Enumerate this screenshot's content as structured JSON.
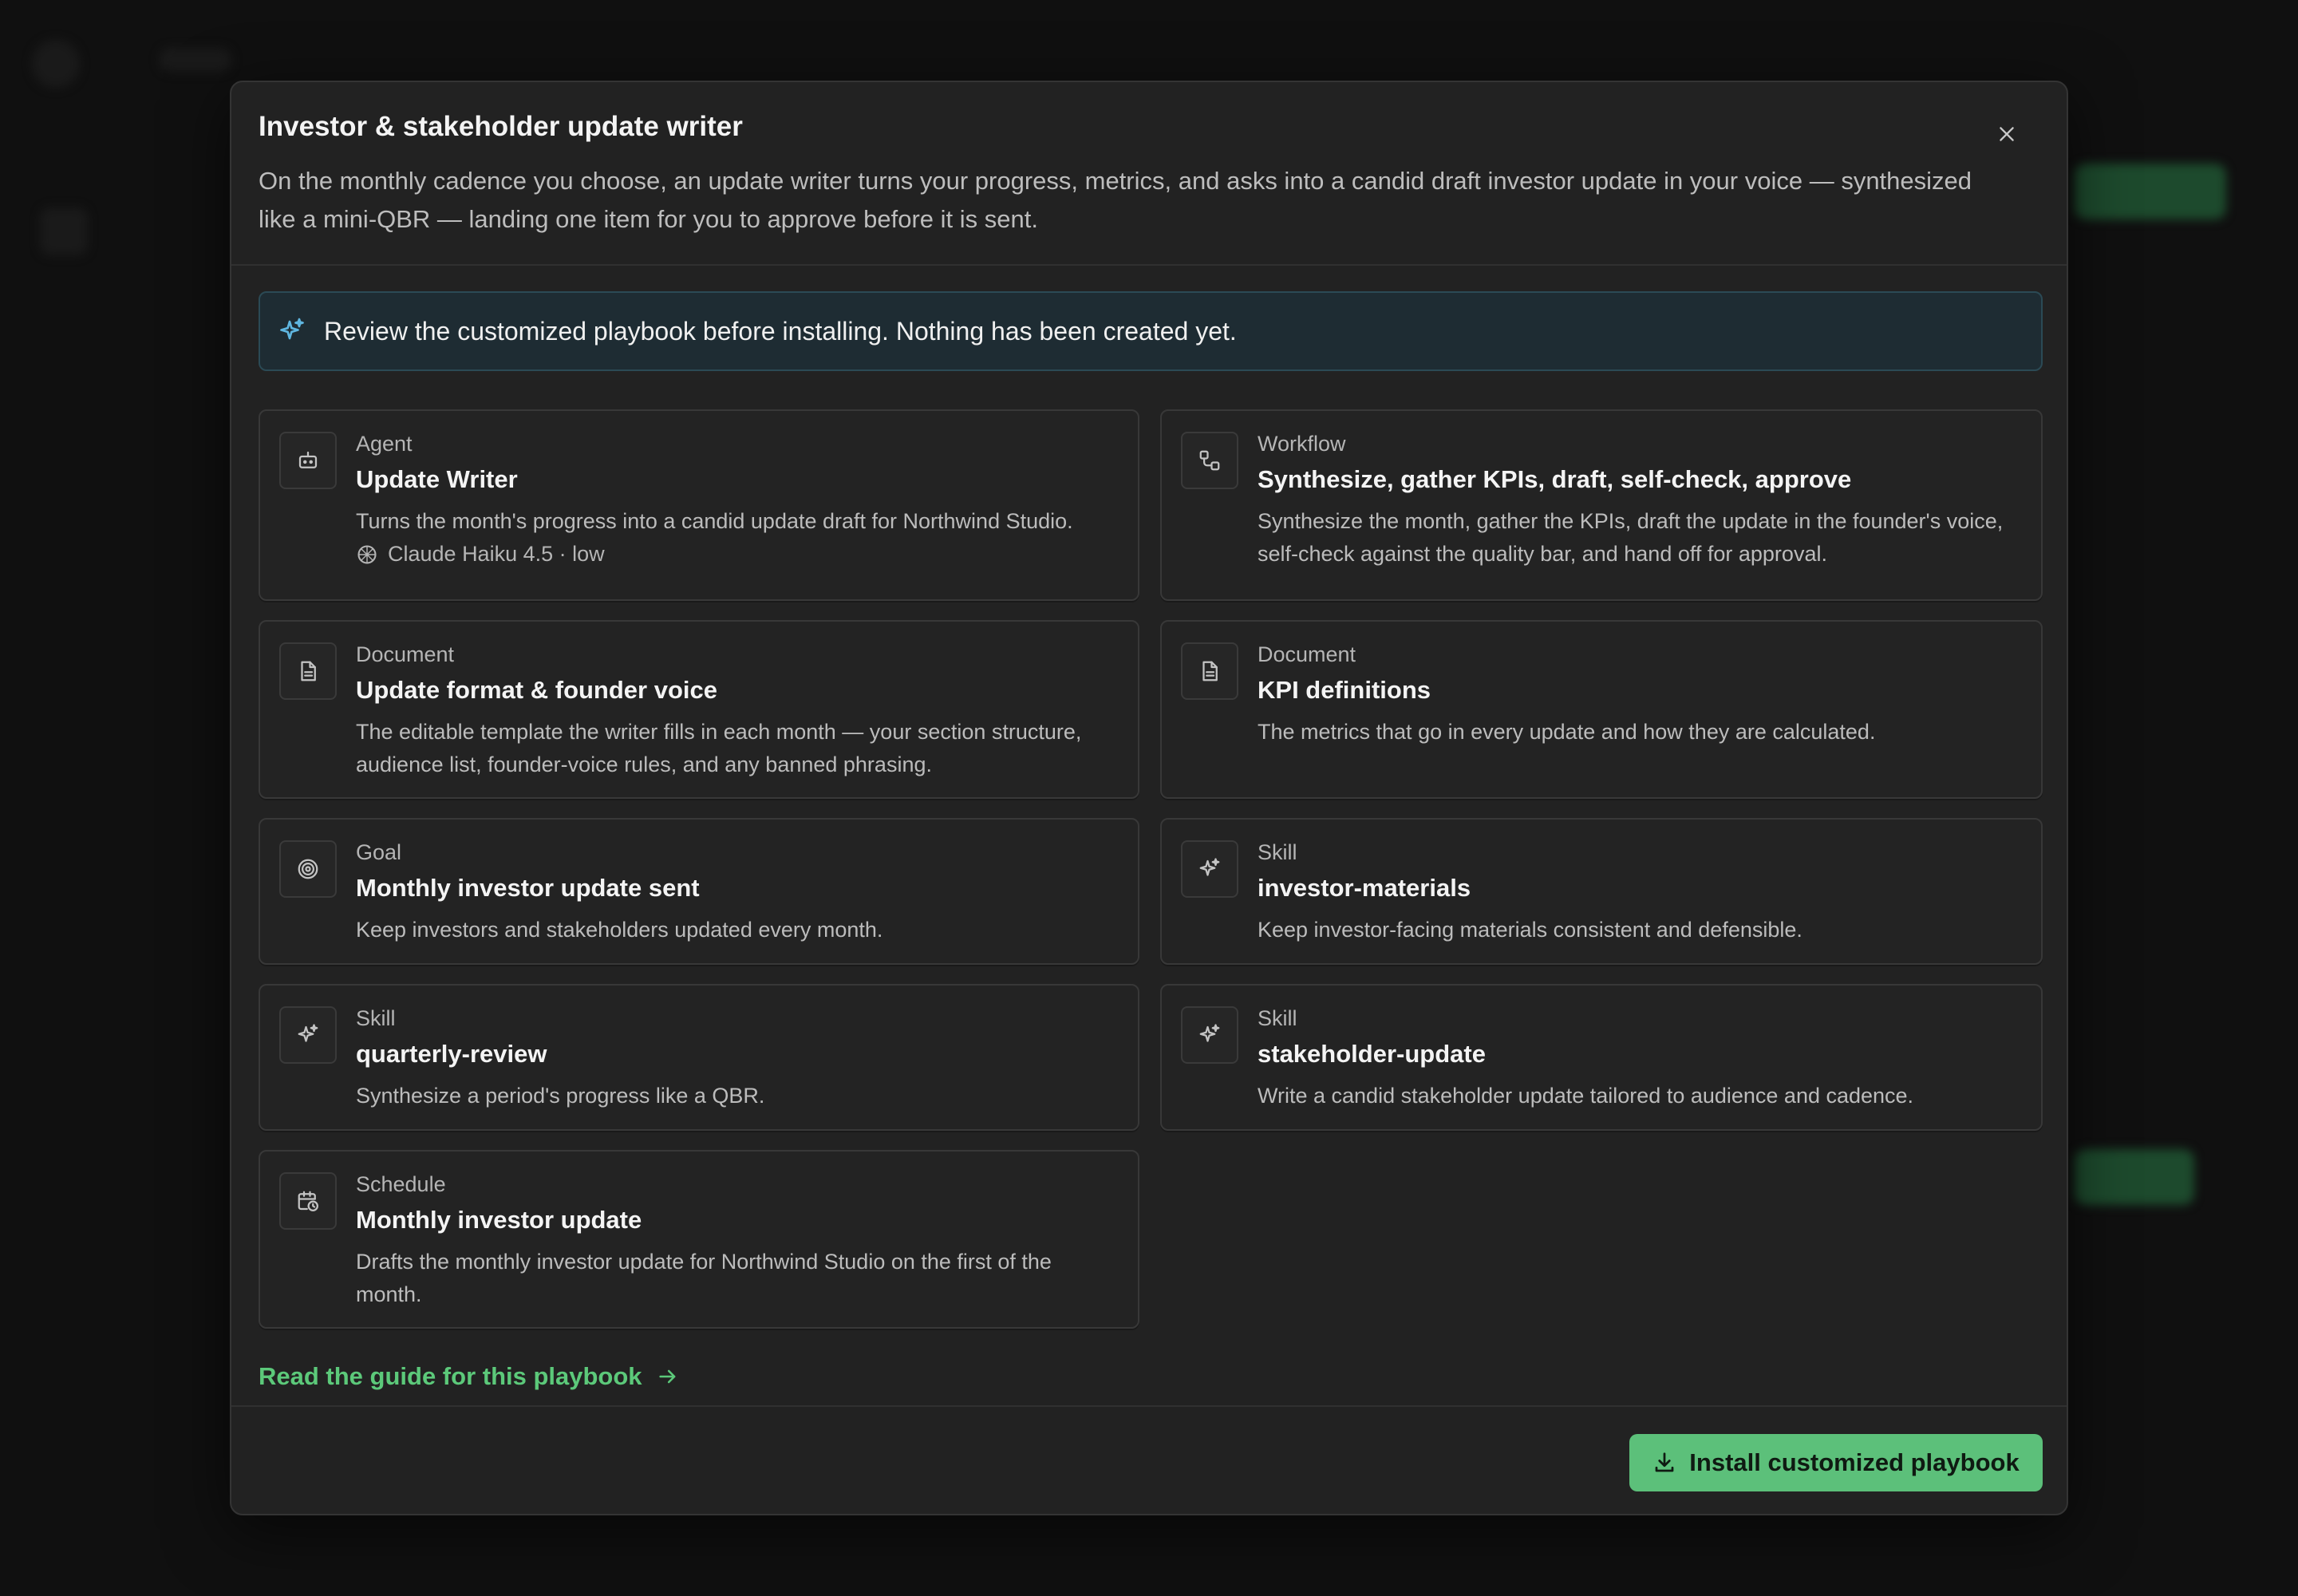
{
  "modal": {
    "title": "Investor & stakeholder update writer",
    "description": "On the monthly cadence you choose, an update writer turns your progress, metrics, and asks into a candid draft investor update in your voice — synthesized like a mini-QBR — landing one item for you to approve before it is sent.",
    "close_icon": "close-icon"
  },
  "notice": {
    "icon": "sparkles-icon",
    "text": "Review the customized playbook before installing. Nothing has been created yet."
  },
  "cards": [
    {
      "type": "Agent",
      "title": "Update Writer",
      "description": "Turns the month's progress into a candid update draft for Northwind Studio.",
      "meta": "Claude Haiku 4.5 · low",
      "icon": "bot-icon"
    },
    {
      "type": "Workflow",
      "title": "Synthesize, gather KPIs, draft, self-check, approve",
      "description": "Synthesize the month, gather the KPIs, draft the update in the founder's voice, self-check against the quality bar, and hand off for approval.",
      "icon": "workflow-icon"
    },
    {
      "type": "Document",
      "title": "Update format & founder voice",
      "description": "The editable template the writer fills in each month — your section structure, audience list, founder-voice rules, and any banned phrasing.",
      "icon": "document-icon"
    },
    {
      "type": "Document",
      "title": "KPI definitions",
      "description": "The metrics that go in every update and how they are calculated.",
      "icon": "document-icon"
    },
    {
      "type": "Goal",
      "title": "Monthly investor update sent",
      "description": "Keep investors and stakeholders updated every month.",
      "icon": "target-icon"
    },
    {
      "type": "Skill",
      "title": "investor-materials",
      "description": "Keep investor-facing materials consistent and defensible.",
      "icon": "sparkles-icon"
    },
    {
      "type": "Skill",
      "title": "quarterly-review",
      "description": "Synthesize a period's progress like a QBR.",
      "icon": "sparkles-icon"
    },
    {
      "type": "Skill",
      "title": "stakeholder-update",
      "description": "Write a candid stakeholder update tailored to audience and cadence.",
      "icon": "sparkles-icon"
    },
    {
      "type": "Schedule",
      "title": "Monthly investor update",
      "description": "Drafts the monthly investor update for Northwind Studio on the first of the month.",
      "icon": "calendar-clock-icon"
    }
  ],
  "guide_link": "Read the guide for this playbook",
  "install_button": "Install customized playbook",
  "colors": {
    "accent": "#5cc07a",
    "link": "#5cc97a",
    "modal_bg": "#222222",
    "notice_bg": "#1e2c33"
  }
}
